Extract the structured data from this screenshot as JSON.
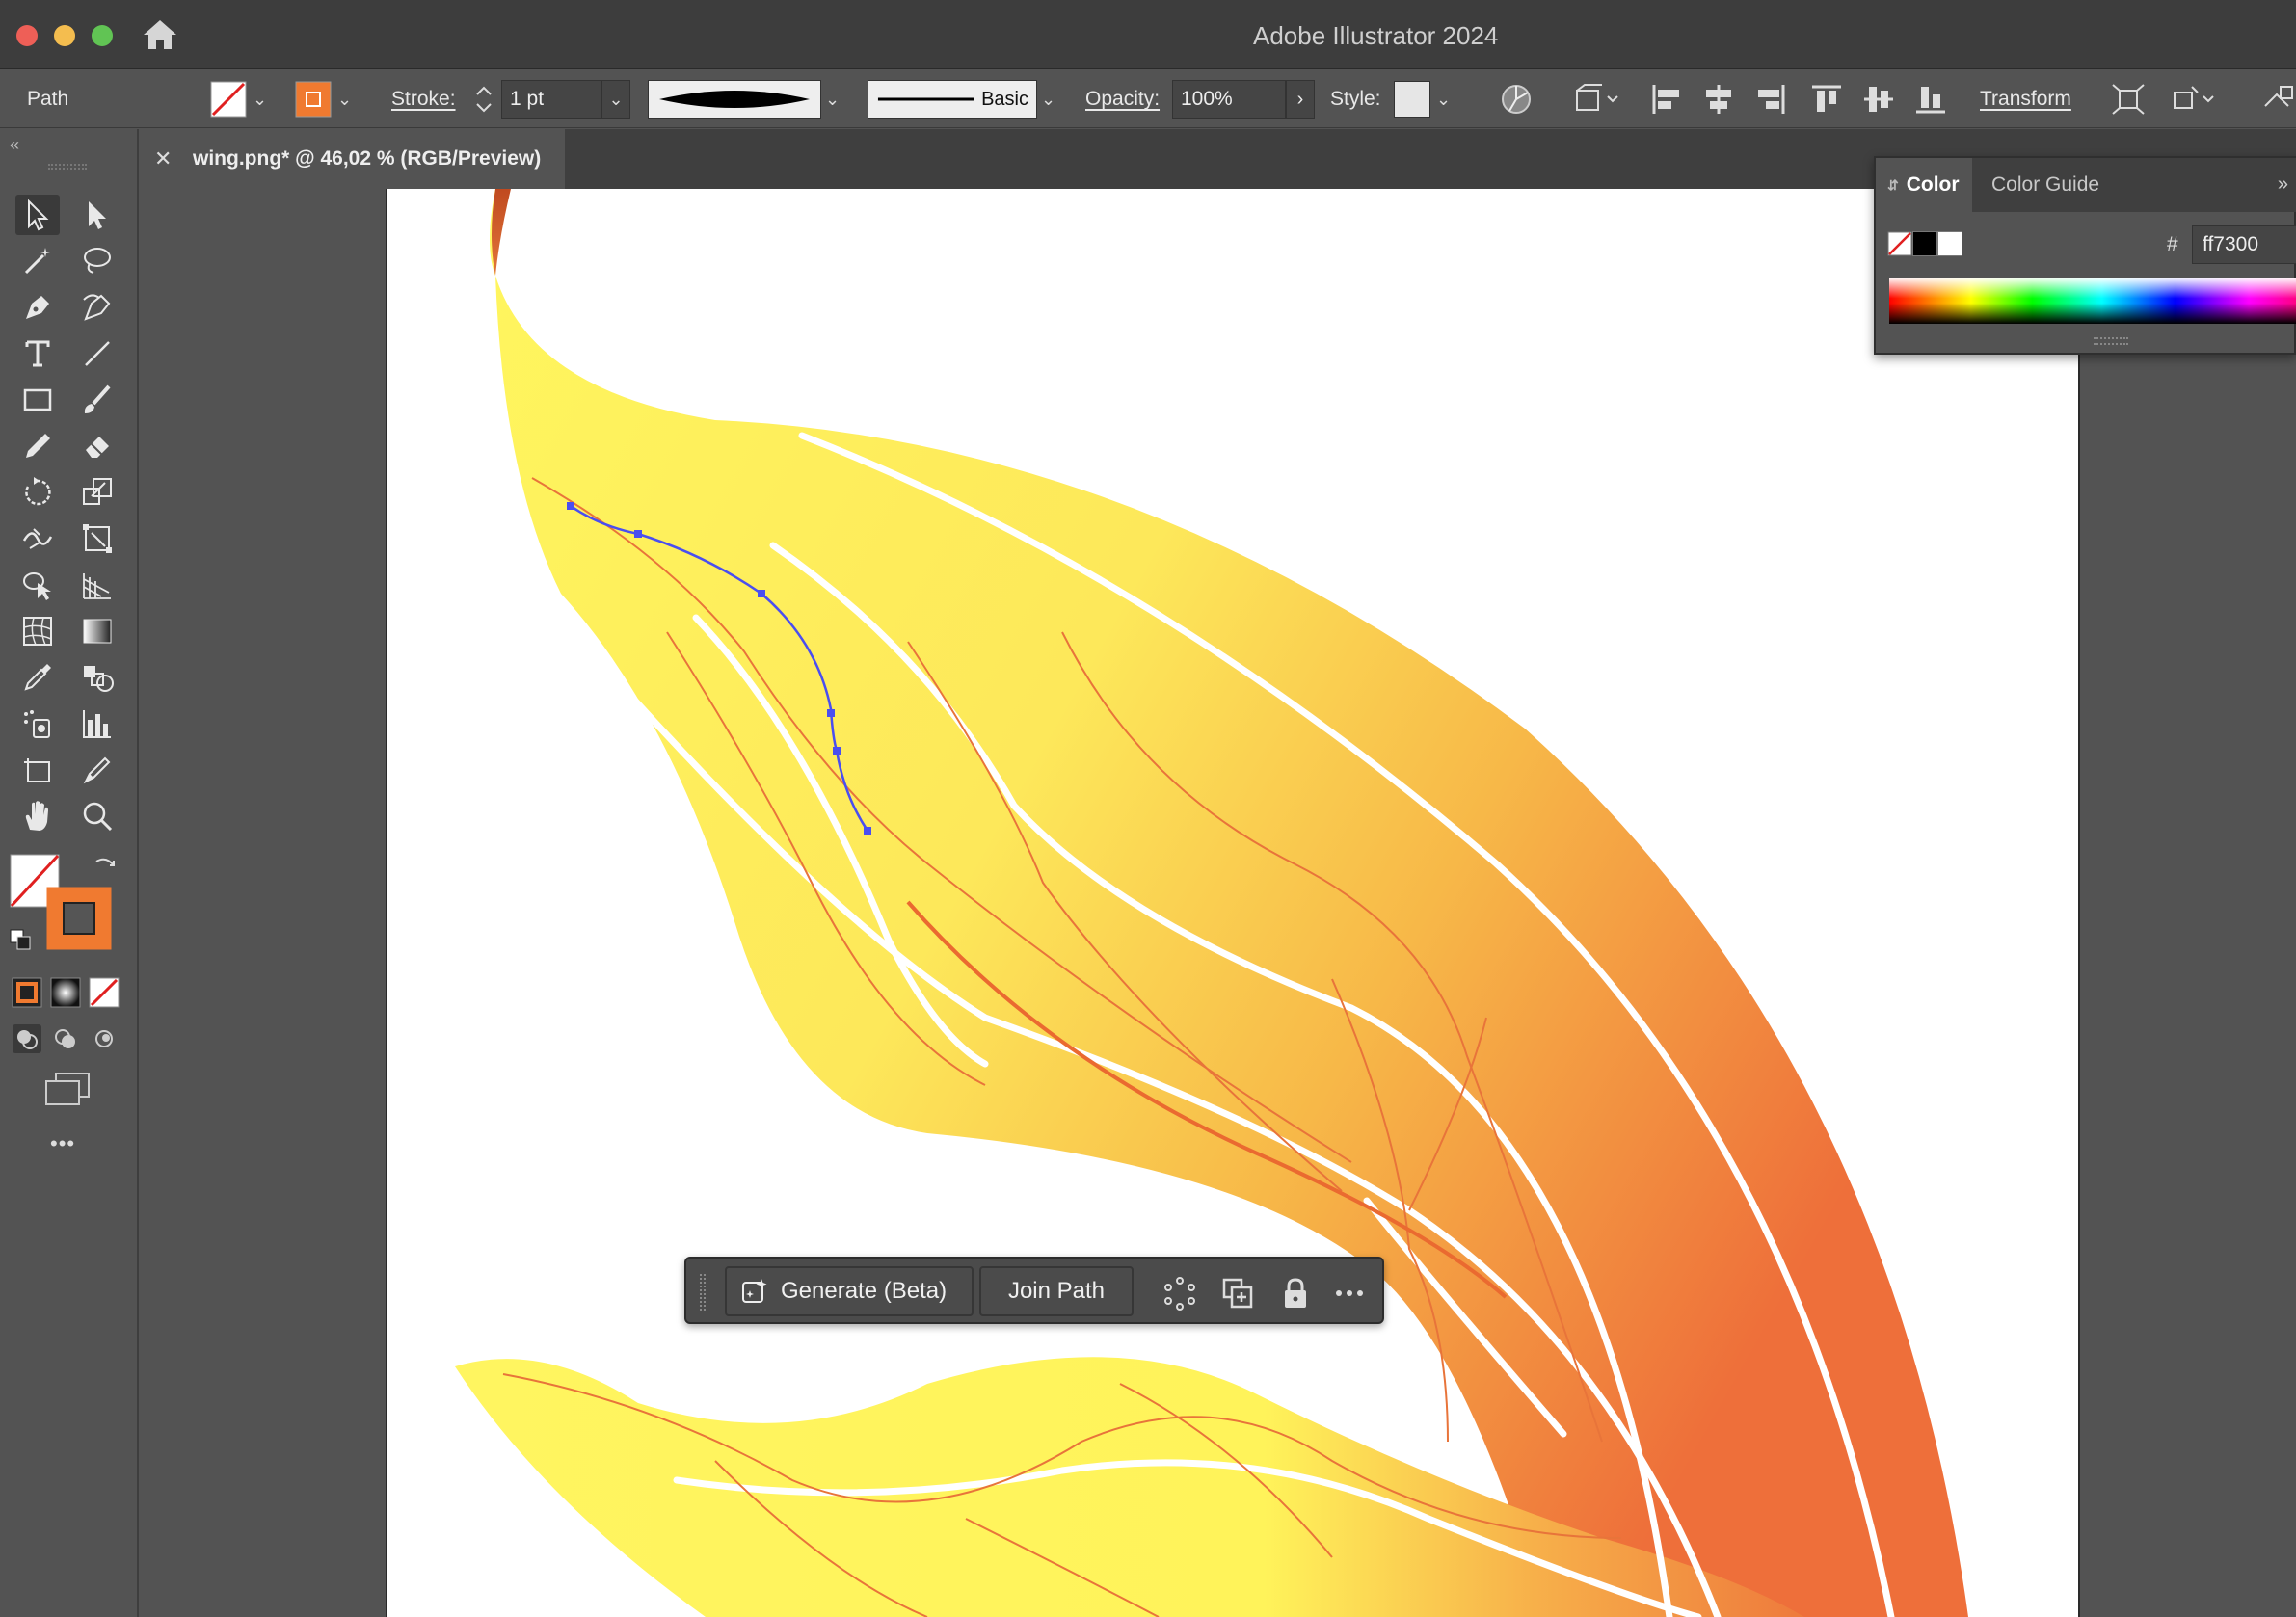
{
  "window": {
    "title": "Adobe Illustrator 2024"
  },
  "controlbar": {
    "selection_type": "Path",
    "stroke_label": "Stroke:",
    "stroke_weight": "1 pt",
    "brush_label": "Basic",
    "opacity_label": "Opacity:",
    "opacity_value": "100%",
    "style_label": "Style:",
    "transform_label": "Transform",
    "fill_color": "none",
    "stroke_color": "#f07a30"
  },
  "document": {
    "tab_title": "wing.png* @ 46,02 % (RGB/Preview)"
  },
  "toolbar": {
    "more_label": "•••"
  },
  "taskbar": {
    "generate_label": "Generate (Beta)",
    "join_label": "Join Path"
  },
  "color_panel": {
    "tabs": [
      "Color",
      "Color Guide"
    ],
    "hash_label": "#",
    "hex_value": "ff7300"
  },
  "colors": {
    "accent_orange": "#f07a30",
    "wing_yellow": "#fff55a",
    "wing_orange": "#ef7a3c",
    "selection_blue": "#4a4ef0"
  }
}
